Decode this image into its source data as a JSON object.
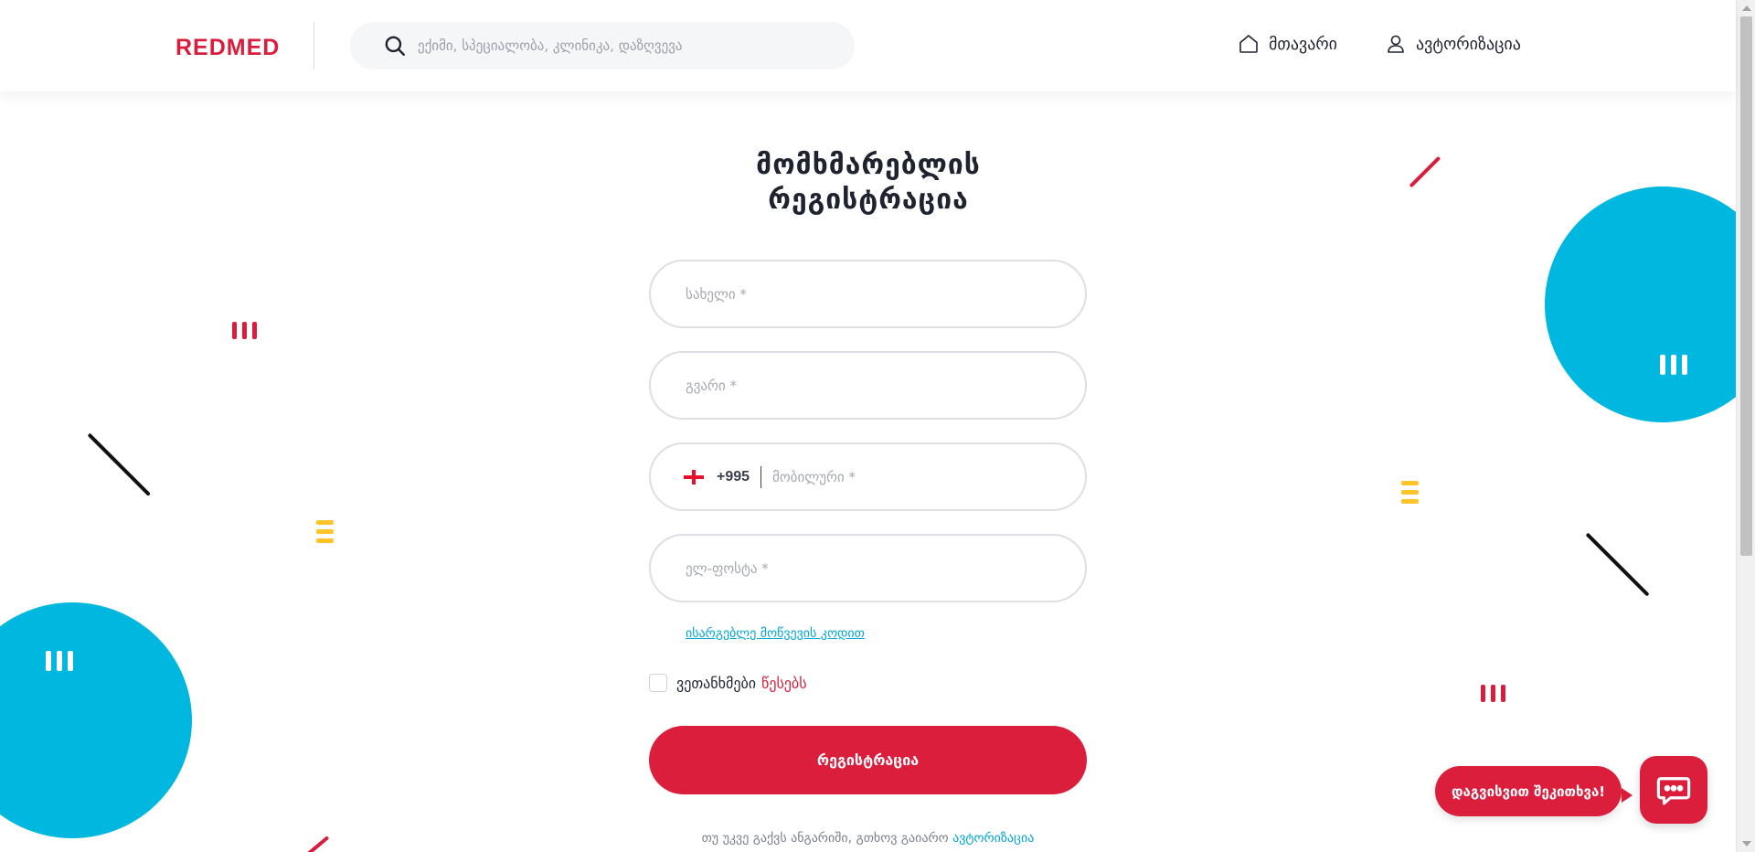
{
  "header": {
    "logo": "REDMED",
    "search_placeholder": "ექიმი, სპეციალობა, კლინიკა, დაზღვევა",
    "nav": {
      "home": "მთავარი",
      "auth": "ავტორიზაცია"
    }
  },
  "form": {
    "title_line1": "მომხმარებლის",
    "title_line2": "რეგისტრაცია",
    "first_name_placeholder": "სახელი *",
    "last_name_placeholder": "გვარი *",
    "phone_code": "+995",
    "phone_placeholder": "მობილური *",
    "email_placeholder": "ელ-ფოსტა *",
    "promo_link": "ისარგებლე მოწვევის კოდით",
    "agree_text": "ვეთანხმები",
    "rules_link": "წესებს",
    "submit": "რეგისტრაცია",
    "login_prompt": "თუ უკვე გაქვს ანგარიში, გთხოვ გაიარო",
    "login_link": "ავტორიზაცია"
  },
  "chat": {
    "bubble_text": "დაგვისვით შეკითხვა!"
  },
  "colors": {
    "brand_red": "#da1e3c",
    "accent_blue": "#00b7e0",
    "accent_yellow": "#ffc42a",
    "link_blue": "#00a6d6"
  },
  "icons": {
    "search": "search-icon",
    "home": "home-icon",
    "user": "user-icon",
    "chat": "chat-icon",
    "flag": "georgia-flag-icon"
  }
}
